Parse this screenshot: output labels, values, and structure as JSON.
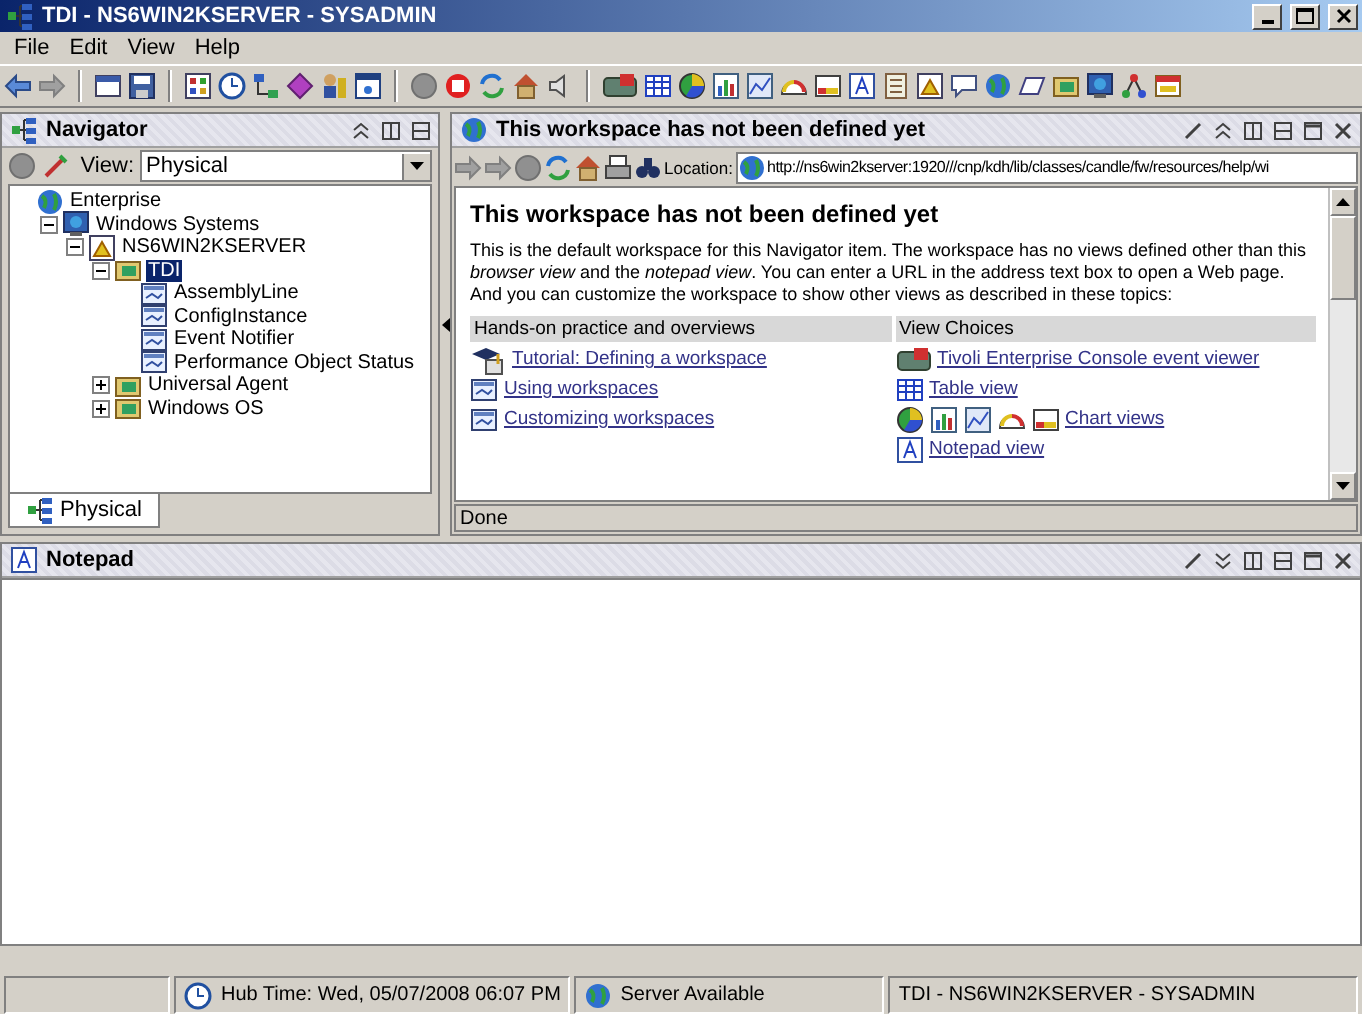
{
  "window": {
    "title": "TDI - NS6WIN2KSERVER - SYSADMIN"
  },
  "menu": [
    "File",
    "Edit",
    "View",
    "Help"
  ],
  "navigator": {
    "title": "Navigator",
    "view_label": "View:",
    "view_value": "Physical",
    "tree": [
      {
        "label": "Enterprise",
        "kind": "enterprise",
        "selected": false,
        "children": [
          {
            "label": "Windows Systems",
            "kind": "systems",
            "expanded": true,
            "selected": false,
            "children": [
              {
                "label": "NS6WIN2KSERVER",
                "kind": "server",
                "expanded": true,
                "selected": false,
                "children": [
                  {
                    "label": "TDI",
                    "kind": "agent",
                    "expanded": true,
                    "selected": true,
                    "children": [
                      {
                        "label": "AssemblyLine",
                        "kind": "workspace",
                        "selected": false
                      },
                      {
                        "label": "ConfigInstance",
                        "kind": "workspace",
                        "selected": false
                      },
                      {
                        "label": "Event Notifier",
                        "kind": "workspace",
                        "selected": false
                      },
                      {
                        "label": "Performance Object Status",
                        "kind": "workspace",
                        "selected": false
                      }
                    ]
                  },
                  {
                    "label": "Universal Agent",
                    "kind": "agent",
                    "expanded": false,
                    "selected": false
                  },
                  {
                    "label": "Windows OS",
                    "kind": "agent",
                    "expanded": false,
                    "selected": false
                  }
                ]
              }
            ]
          }
        ]
      }
    ],
    "tabs": [
      {
        "label": "Physical",
        "selected": true
      }
    ]
  },
  "browser": {
    "title": "This workspace has not been defined yet",
    "location_label": "Location:",
    "url": "http://ns6win2kserver:1920///cnp/kdh/lib/classes/candle/fw/resources/help/wi",
    "heading": "This workspace has not been defined yet",
    "paragraph": "This is the default workspace for this Navigator item. The workspace has no views defined other than this *browser view* and the *notepad view*. You can enter a URL in the address text box to open a Web page. And you can customize the workspace to show other views as described in these topics:",
    "columns": [
      {
        "header": "Hands-on practice and overviews",
        "links": [
          {
            "label": "Tutorial: Defining a workspace",
            "kind": "tutorial"
          },
          {
            "label": "Using workspaces",
            "kind": "workspace"
          },
          {
            "label": "Customizing workspaces",
            "kind": "workspace"
          }
        ]
      },
      {
        "header": "View Choices",
        "links": [
          {
            "label": "Tivoli Enterprise Console event viewer",
            "kind": "console"
          },
          {
            "label": "Table view",
            "kind": "table"
          },
          {
            "label": "Chart views",
            "kind": "charts"
          },
          {
            "label": "Notepad view",
            "kind": "notepad"
          }
        ]
      }
    ],
    "status": "Done"
  },
  "notepad": {
    "title": "Notepad"
  },
  "status_bar": [
    {
      "label": "Hub Time: Wed, 05/07/2008 06:07 PM",
      "kind": "clock"
    },
    {
      "label": "Server Available",
      "kind": "globe"
    },
    {
      "label": "TDI - NS6WIN2KSERVER - SYSADMIN",
      "kind": "text"
    }
  ]
}
